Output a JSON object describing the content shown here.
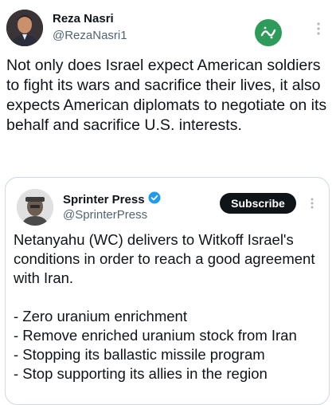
{
  "author": {
    "name": "Reza Nasri",
    "handle": "@RezaNasri1",
    "avatar_icon": "person-avatar"
  },
  "brand_logo": {
    "icon": "green-circle-persian-logo",
    "color": "#2e9b5a"
  },
  "tweet": {
    "text": "Not only does Israel expect American soldiers to fight its wars and sacrifice their lives, it also expects American diplomats to negotiate on its behalf and sacrifice U.S. interests."
  },
  "quoted": {
    "name": "Sprinter Press",
    "handle": "@SprinterPress",
    "verified_icon": "verified-badge-icon",
    "verified_color": "#1d9bf0",
    "subscribe_label": "Subscribe",
    "paragraph": "Netanyahu (WC) delivers to Witkoff Israel's conditions in order to reach a good agreement with Iran.",
    "items": [
      "- Zero uranium enrichment",
      "- Remove enriched uranium stock from Iran",
      "- Stopping its ballastic missile program",
      "- Stop supporting its allies in the region"
    ]
  }
}
